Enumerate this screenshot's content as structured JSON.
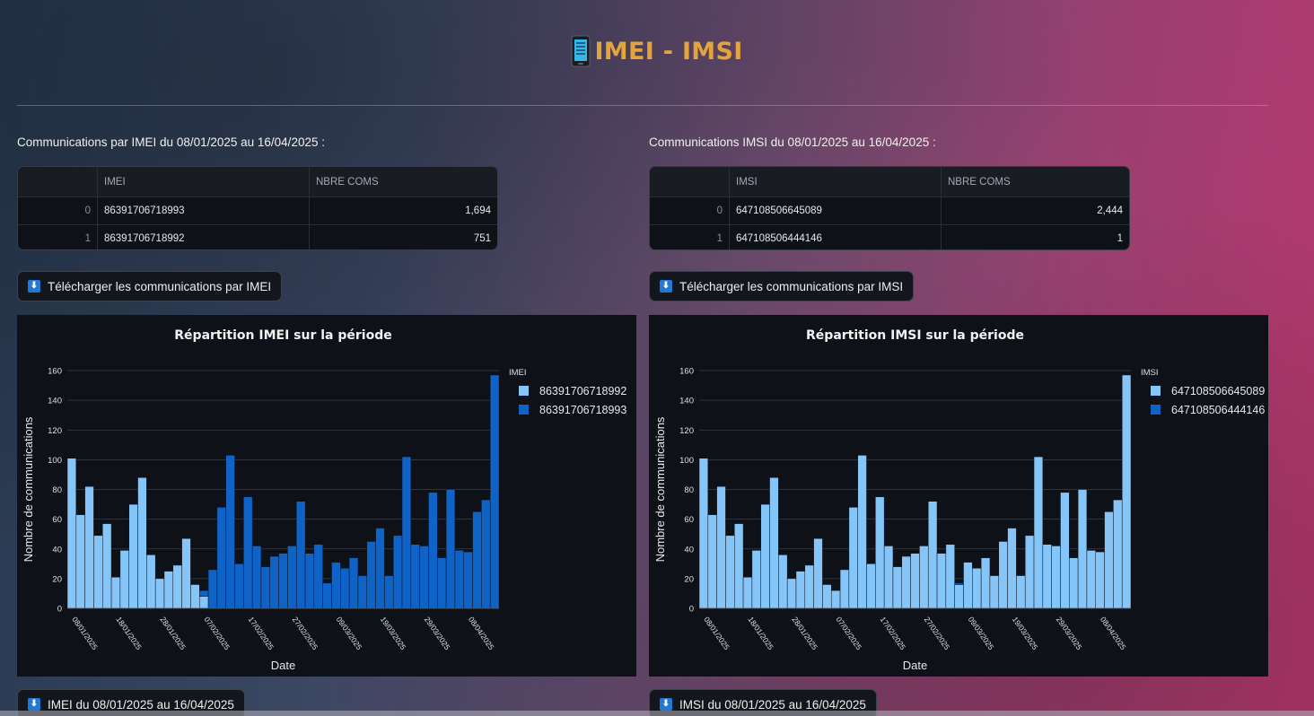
{
  "header": {
    "title": "IMEI - IMSI",
    "icon": "mobile-phone-icon"
  },
  "colors": {
    "title": "#e3a53b",
    "series_light": "#86c5f7",
    "series_dark": "#0f63c7",
    "panel_bg": "#0e1117"
  },
  "imei": {
    "section_label": "Communications par IMEI du 08/01/2025 au 16/04/2025 :",
    "table": {
      "columns": [
        "",
        "IMEI",
        "NBRE COMS"
      ],
      "rows": [
        [
          "0",
          "86391706718993",
          "1,694"
        ],
        [
          "1",
          "86391706718992",
          "751"
        ]
      ]
    },
    "download_button": "Télécharger les communications par IMEI",
    "bottom_button": "IMEI du 08/01/2025 au 16/04/2025"
  },
  "imsi": {
    "section_label": "Communications IMSI du 08/01/2025 au 16/04/2025 :",
    "table": {
      "columns": [
        "",
        "IMSI",
        "NBRE COMS"
      ],
      "rows": [
        [
          "0",
          "647108506645089",
          "2,444"
        ],
        [
          "1",
          "647108506444146",
          "1"
        ]
      ]
    },
    "download_button": "Télécharger les communications par IMSI",
    "bottom_button": "IMSI du 08/01/2025 au 16/04/2025"
  },
  "chart_data": [
    {
      "type": "bar",
      "title": "Répartition IMEI sur la période",
      "xlabel": "Date",
      "ylabel": "Nombre de communications",
      "ylim": [
        0,
        160
      ],
      "yticks": [
        0,
        20,
        40,
        60,
        80,
        100,
        120,
        140,
        160
      ],
      "xtick_labels": [
        "08/01/2025",
        "18/01/2025",
        "28/01/2025",
        "07/02/2025",
        "17/02/2025",
        "27/02/2025",
        "09/03/2025",
        "19/03/2025",
        "29/03/2025",
        "08/04/2025"
      ],
      "legend_title": "IMEI",
      "legend_position": "right",
      "stacked": true,
      "grid": true,
      "series": [
        {
          "name": "86391706718992",
          "color": "#86c5f7",
          "values": [
            101,
            63,
            82,
            49,
            57,
            21,
            39,
            70,
            88,
            36,
            20,
            25,
            29,
            47,
            16,
            8,
            0,
            0,
            0,
            0,
            0,
            0,
            0,
            0,
            0,
            0,
            0,
            0,
            0,
            0,
            0,
            0,
            0,
            0,
            0,
            0,
            0,
            0,
            0,
            0,
            0,
            0,
            0,
            0,
            0,
            0,
            0,
            0,
            0
          ]
        },
        {
          "name": "86391706718993",
          "color": "#0f63c7",
          "values": [
            0,
            0,
            0,
            0,
            0,
            0,
            0,
            0,
            0,
            0,
            0,
            0,
            0,
            0,
            0,
            4,
            26,
            68,
            103,
            30,
            75,
            42,
            28,
            35,
            37,
            42,
            72,
            37,
            43,
            17,
            31,
            27,
            34,
            22,
            45,
            54,
            22,
            49,
            102,
            43,
            42,
            78,
            34,
            80,
            39,
            38,
            65,
            73,
            157
          ]
        }
      ]
    },
    {
      "type": "bar",
      "title": "Répartition IMSI sur la période",
      "xlabel": "Date",
      "ylabel": "Nombre de communications",
      "ylim": [
        0,
        160
      ],
      "yticks": [
        0,
        20,
        40,
        60,
        80,
        100,
        120,
        140,
        160
      ],
      "xtick_labels": [
        "08/01/2025",
        "18/01/2025",
        "28/01/2025",
        "07/02/2025",
        "17/02/2025",
        "27/02/2025",
        "09/03/2025",
        "19/03/2025",
        "29/03/2025",
        "08/04/2025"
      ],
      "legend_title": "IMSI",
      "legend_position": "right",
      "stacked": true,
      "grid": true,
      "series": [
        {
          "name": "647108506645089",
          "color": "#86c5f7",
          "values": [
            101,
            63,
            82,
            49,
            57,
            21,
            39,
            70,
            88,
            36,
            20,
            25,
            29,
            47,
            16,
            12,
            26,
            68,
            103,
            30,
            75,
            42,
            28,
            35,
            37,
            42,
            72,
            37,
            43,
            16,
            31,
            27,
            34,
            22,
            45,
            54,
            22,
            49,
            102,
            43,
            42,
            78,
            34,
            80,
            39,
            38,
            65,
            73,
            157
          ]
        },
        {
          "name": "647108506444146",
          "color": "#0f63c7",
          "values": [
            0,
            0,
            0,
            0,
            0,
            0,
            0,
            0,
            0,
            0,
            0,
            0,
            0,
            0,
            0,
            0,
            0,
            0,
            0,
            0,
            0,
            0,
            0,
            0,
            0,
            0,
            0,
            0,
            0,
            1,
            0,
            0,
            0,
            0,
            0,
            0,
            0,
            0,
            0,
            0,
            0,
            0,
            0,
            0,
            0,
            0,
            0,
            0,
            0
          ]
        }
      ]
    }
  ]
}
